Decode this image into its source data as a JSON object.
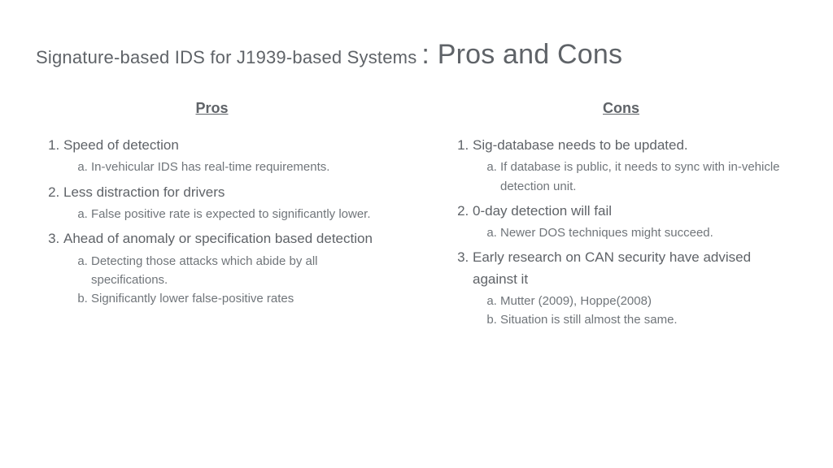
{
  "title": {
    "prefix": "Signature-based IDS for J1939-based Systems",
    "main": ": Pros and Cons"
  },
  "columns": {
    "pros": {
      "header": "Pros",
      "items": [
        {
          "text": "Speed of detection",
          "sub": [
            "In-vehicular IDS has real-time requirements."
          ]
        },
        {
          "text": "Less distraction for drivers",
          "sub": [
            "False positive rate is expected to significantly lower."
          ]
        },
        {
          "text": "Ahead of anomaly or specification based detection",
          "sub": [
            "Detecting those attacks which abide by all specifications.",
            "Significantly lower false-positive rates"
          ]
        }
      ]
    },
    "cons": {
      "header": "Cons",
      "items": [
        {
          "text": "Sig-database needs to be updated.",
          "sub": [
            "If database is public, it needs to sync with in-vehicle detection unit."
          ]
        },
        {
          "text": "0-day detection will fail",
          "sub": [
            "Newer DOS techniques might succeed."
          ]
        },
        {
          "text": "Early research on CAN security have advised against it",
          "sub": [
            "Mutter (2009), Hoppe(2008)",
            "Situation is still almost the same."
          ]
        }
      ]
    }
  }
}
